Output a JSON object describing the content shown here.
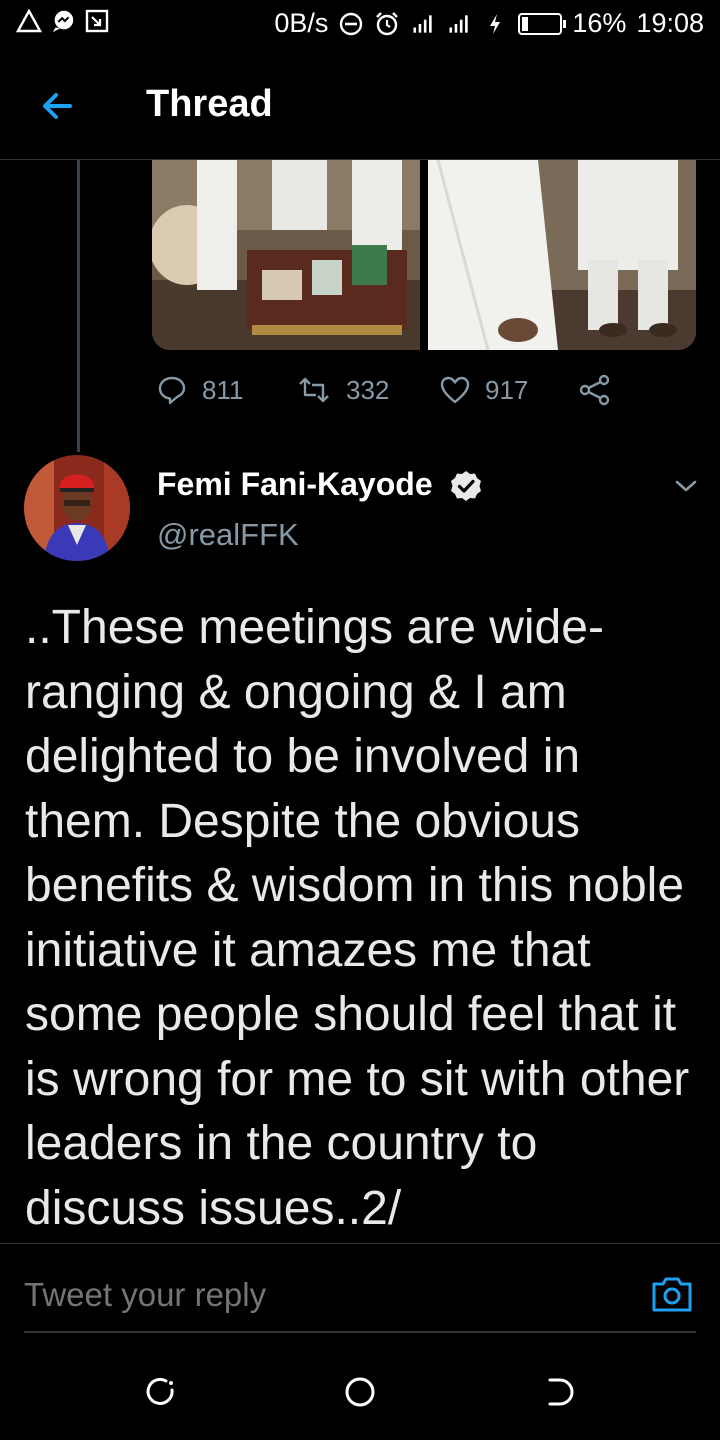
{
  "status_bar": {
    "net_speed": "0B/s",
    "battery_percent": "16%",
    "time": "19:08",
    "battery_level": 0.16,
    "left_icons": [
      "warning-icon",
      "messenger-icon",
      "screenshot-icon"
    ],
    "right_icons": [
      "dnd-icon",
      "alarm-icon",
      "signal-icon",
      "signal-icon",
      "charging-icon",
      "battery-icon"
    ]
  },
  "header": {
    "title": "Thread",
    "back_icon": "arrow-left-icon"
  },
  "previous_tweet": {
    "media": [
      "photo",
      "photo"
    ],
    "stats": {
      "replies": "811",
      "retweets": "332",
      "likes": "917"
    }
  },
  "tweet": {
    "author_name": "Femi Fani-Kayode",
    "handle": "@realFFK",
    "verified": true,
    "text": "..These meetings are wide-ranging & ongoing & I am delighted to be involved in them. Despite the obvious benefits & wisdom in this noble initiative it amazes me that some people should feel that it is wrong for me to sit with other leaders in the country to discuss issues..2/"
  },
  "reply": {
    "placeholder": "Tweet your reply"
  },
  "colors": {
    "accent": "#1da1f2",
    "background": "#000000",
    "secondary_text": "#8899a6",
    "divider": "#2f3336"
  }
}
